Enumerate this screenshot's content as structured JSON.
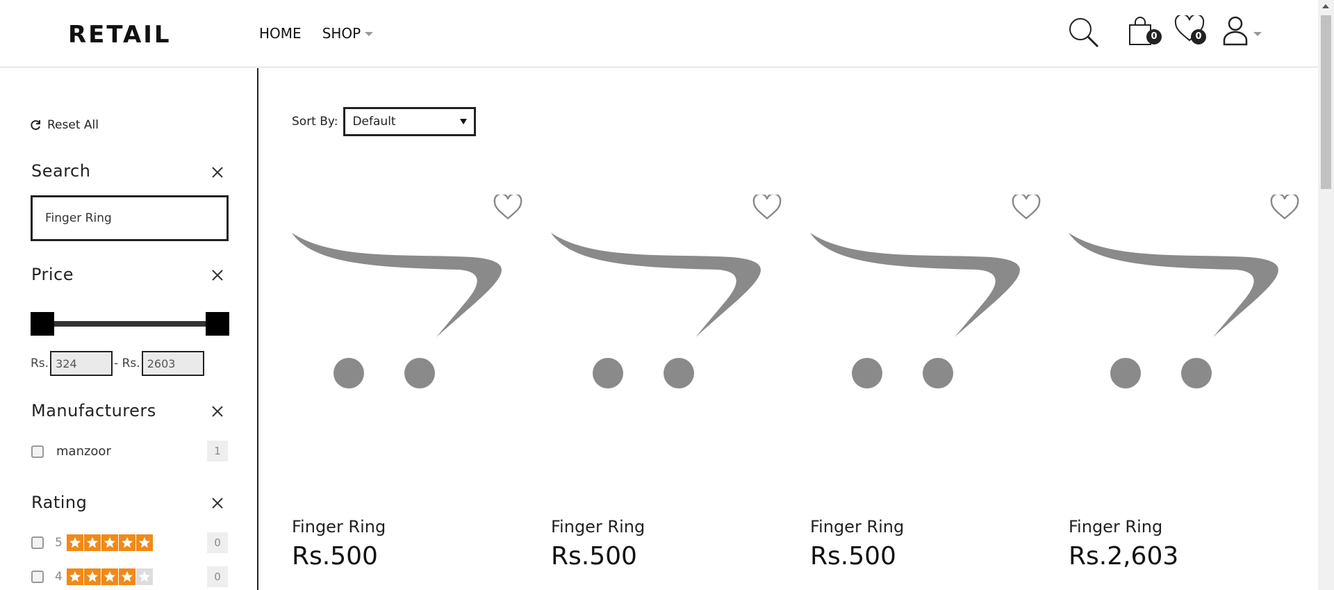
{
  "header": {
    "logo": "RETAIL",
    "nav": [
      {
        "label": "HOME"
      },
      {
        "label": "SHOP"
      }
    ],
    "cart_count": "0",
    "wishlist_count": "0"
  },
  "filters": {
    "reset_label": "Reset All",
    "search": {
      "title": "Search",
      "value": "Finger Ring"
    },
    "price": {
      "title": "Price",
      "currency": "Rs.",
      "min": "324",
      "max": "2603",
      "separator": "- Rs."
    },
    "manufacturers": {
      "title": "Manufacturers",
      "items": [
        {
          "label": "manzoor",
          "count": "1"
        }
      ]
    },
    "rating": {
      "title": "Rating",
      "items": [
        {
          "label": "5",
          "count": "0",
          "stars": 5
        },
        {
          "label": "4",
          "count": "0",
          "stars": 4
        }
      ]
    }
  },
  "sort": {
    "label": "Sort By:",
    "value": "Default"
  },
  "products": [
    {
      "name": "Finger Ring",
      "price": "Rs.500"
    },
    {
      "name": "Finger Ring",
      "price": "Rs.500"
    },
    {
      "name": "Finger Ring",
      "price": "Rs.500"
    },
    {
      "name": "Finger Ring",
      "price": "Rs.2,603"
    }
  ],
  "colors": {
    "star": "#f08a18",
    "placeholder_gray": "#8a8a8a"
  }
}
